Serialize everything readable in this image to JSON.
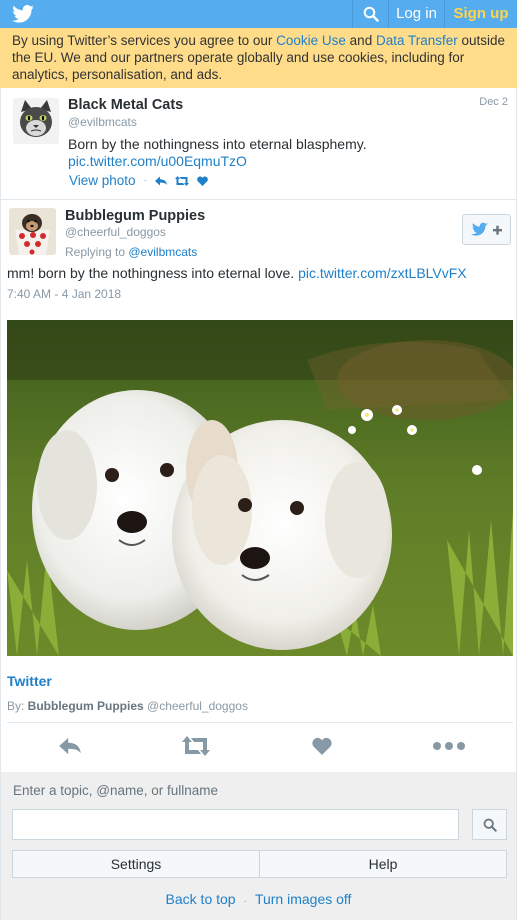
{
  "topbar": {
    "login_label": "Log in",
    "signup_label": "Sign up",
    "brand_color": "#55acee",
    "signup_color": "#ffd449"
  },
  "cookie_banner": {
    "text_start": "By using Twitter’s services you agree to our ",
    "cookie_link": "Cookie Use",
    "text_mid": " and ",
    "data_link": "Data Transfer",
    "text_end": " outside the EU. We and our partners operate globally and use cookies, including for analytics, personalisation, and ads.",
    "background": "#fedc8a"
  },
  "parent_tweet": {
    "name": "Black Metal Cats",
    "handle": "@evilbmcats",
    "date": "Dec 2",
    "text": "Born by the nothingness into eternal blasphemy.",
    "link": "pic.twitter.com/u00EqmuTzO",
    "view_photo": "View photo",
    "dot": "·"
  },
  "main_tweet": {
    "name": "Bubblegum Puppies",
    "handle": "@cheerful_doggos",
    "replying_prefix": "Replying to ",
    "replying_to": "@evilbmcats",
    "text": "mm! born by the nothingness into eternal love. ",
    "link": "pic.twitter.com/zxtLBLVvFX",
    "timestamp": "7:40 AM - 4 Jan 2018",
    "source": "Twitter",
    "by_label": "By: ",
    "by_name": "Bubblegum Puppies",
    "by_handle": "@cheerful_doggos"
  },
  "footer": {
    "search_label": "Enter a topic, @name, or fullname",
    "search_value": "",
    "settings_label": "Settings",
    "help_label": "Help",
    "back_to_top": "Back to top",
    "separator": "·",
    "turn_images_off": "Turn images off"
  },
  "colors": {
    "link": "#1f80c9",
    "muted": "#8899a6"
  },
  "icons": [
    "twitter-bird-icon",
    "search-icon",
    "reply-icon",
    "retweet-icon",
    "like-icon",
    "more-icon",
    "follow-icon"
  ]
}
